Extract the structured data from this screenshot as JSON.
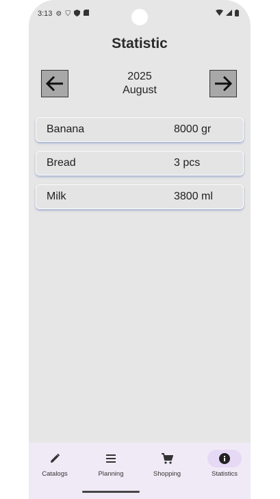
{
  "status_bar": {
    "time": "3:13"
  },
  "page": {
    "title": "Statistic"
  },
  "period": {
    "year": "2025",
    "month": "August"
  },
  "items": [
    {
      "name": "Banana",
      "quantity": "8000 gr"
    },
    {
      "name": "Bread",
      "quantity": "3 pcs"
    },
    {
      "name": "Milk",
      "quantity": "3800 ml"
    }
  ],
  "bottom_nav": {
    "tabs": [
      {
        "label": "Catalogs",
        "icon": "pencil-icon"
      },
      {
        "label": "Planning",
        "icon": "list-icon"
      },
      {
        "label": "Shopping",
        "icon": "cart-icon"
      },
      {
        "label": "Statistics",
        "icon": "info-icon",
        "active": true
      }
    ]
  },
  "colors": {
    "background": "#e6e6e6",
    "nav_bar": "#f0eaf6",
    "active_tab": "#e6d9f6",
    "nav_button": "#a8a8a8"
  }
}
